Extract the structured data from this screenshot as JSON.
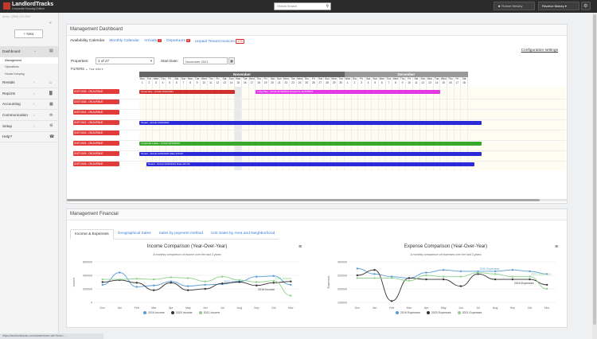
{
  "topbar": {
    "logo_main": "LandlordTracks",
    "logo_sub": "Corporate Housing Edition",
    "search_placeholder": "Global Search",
    "user_button": "Robert Wesley",
    "money_button": "Receive Money"
  },
  "sidebar": {
    "url_text": "demo • (555) 123-4567",
    "new_label": "+ New",
    "items": [
      {
        "label": "Dashboard",
        "active": true,
        "icon": "dashboard-icon",
        "glyph": "▤"
      },
      {
        "label": "Rentals",
        "icon": "home-icon",
        "glyph": "⌂"
      },
      {
        "label": "Reports",
        "icon": "bar-chart-icon",
        "glyph": "▓"
      },
      {
        "label": "Accounting",
        "icon": "calculator-icon",
        "glyph": "▦"
      },
      {
        "label": "Communication",
        "icon": "envelope-icon",
        "glyph": "✉"
      },
      {
        "label": "Setup",
        "icon": "gear-icon",
        "glyph": "⚙"
      },
      {
        "label": "Help?",
        "icon": "headset-icon",
        "glyph": "☎"
      }
    ],
    "subitems": [
      "Management",
      "Operations",
      "House Keeping"
    ]
  },
  "dashboard": {
    "title": "Management Dashboard",
    "tabs": [
      {
        "label": "Availability Calendar",
        "active": true
      },
      {
        "label": "Monthly Calendar"
      },
      {
        "label": "Arrivals",
        "badge": "2"
      },
      {
        "label": "Departures",
        "badge": "8"
      },
      {
        "label": "Unpaid Tenant Invoices",
        "badge": "175",
        "outline": true
      }
    ],
    "config_link": "Configuration settings",
    "properties_label": "Properties:",
    "properties_value": "1 of 27",
    "start_date_label": "Start Date:",
    "start_date_value": "November 2021",
    "filters_label": "FILTERS",
    "filters_hint": "Your units ▾",
    "months": [
      "November",
      "December"
    ],
    "days_nov": [
      {
        "w": "Mon",
        "d": "1"
      },
      {
        "w": "Tue",
        "d": "2"
      },
      {
        "w": "Wed",
        "d": "3"
      },
      {
        "w": "Thu",
        "d": "4"
      },
      {
        "w": "Fri",
        "d": "5"
      },
      {
        "w": "Sat",
        "d": "6"
      },
      {
        "w": "Sun",
        "d": "7"
      },
      {
        "w": "Mon",
        "d": "8"
      },
      {
        "w": "Tue",
        "d": "9"
      },
      {
        "w": "Wed",
        "d": "10"
      },
      {
        "w": "Thu",
        "d": "11"
      },
      {
        "w": "Fri",
        "d": "12"
      },
      {
        "w": "Sat",
        "d": "13"
      },
      {
        "w": "Sun",
        "d": "14"
      },
      {
        "w": "Mon",
        "d": "15"
      },
      {
        "w": "Tue",
        "d": "16"
      },
      {
        "w": "Wed",
        "d": "17"
      },
      {
        "w": "Thu",
        "d": "18"
      },
      {
        "w": "Fri",
        "d": "19"
      },
      {
        "w": "Sat",
        "d": "20"
      },
      {
        "w": "Sun",
        "d": "21"
      },
      {
        "w": "Mon",
        "d": "22"
      },
      {
        "w": "Tue",
        "d": "23"
      },
      {
        "w": "Wed",
        "d": "24"
      },
      {
        "w": "Thu",
        "d": "25"
      },
      {
        "w": "Fri",
        "d": "26"
      },
      {
        "w": "Sat",
        "d": "27"
      },
      {
        "w": "Sun",
        "d": "28"
      },
      {
        "w": "Mon",
        "d": "29"
      },
      {
        "w": "Tue",
        "d": "30"
      }
    ],
    "days_dec": [
      {
        "w": "Wed",
        "d": "1"
      },
      {
        "w": "Thu",
        "d": "2"
      },
      {
        "w": "Fri",
        "d": "3"
      },
      {
        "w": "Sat",
        "d": "4"
      },
      {
        "w": "Sun",
        "d": "5"
      },
      {
        "w": "Mon",
        "d": "6"
      },
      {
        "w": "Tue",
        "d": "7"
      },
      {
        "w": "Wed",
        "d": "8"
      },
      {
        "w": "Thu",
        "d": "9"
      },
      {
        "w": "Fri",
        "d": "10"
      },
      {
        "w": "Sat",
        "d": "11"
      },
      {
        "w": "Sun",
        "d": "12"
      },
      {
        "w": "Mon",
        "d": "13"
      },
      {
        "w": "Tue",
        "d": "14"
      },
      {
        "w": "Wed",
        "d": "15"
      },
      {
        "w": "Thu",
        "d": "16"
      },
      {
        "w": "Fri",
        "d": "17"
      },
      {
        "w": "Sat",
        "d": "18"
      }
    ],
    "units": [
      {
        "name": "UNIT 0035 - ON AVENUE"
      },
      {
        "name": "UNIT 0036 - ON AVENUE"
      },
      {
        "name": "UNIT 0041 - ON AVENUE"
      },
      {
        "name": "UNIT 0042 - ON AVENUE"
      },
      {
        "name": "UNIT 0043 - ON AVENUE"
      },
      {
        "name": "UNIT 0044 - ON AVENUE"
      },
      {
        "name": "UNIT 0045 - ON AVENUE"
      },
      {
        "name": "UNIT 0046 - ON AVENUE"
      }
    ],
    "bookings": [
      {
        "row": 0,
        "start_day": 1,
        "end_day": 14,
        "color": "#d0302f",
        "text": "Guest stay - Arrival 11/01/2021"
      },
      {
        "row": 0,
        "start_day": 18,
        "end_day": 44,
        "color": "#e238e8",
        "text": "Long Stay - Arrival 11/18/2021 Departure 12/12/2021"
      },
      {
        "row": 3,
        "start_day": 1,
        "end_day": 50,
        "color": "#2a2ad8",
        "text": "Tenant - Arrival 11/01/2021"
      },
      {
        "row": 5,
        "start_day": 1,
        "end_day": 50,
        "color": "#3aa82a",
        "text": "Corporate Lease - Arrival 10/15/2021"
      },
      {
        "row": 6,
        "start_day": 1,
        "end_day": 50,
        "color": "#2a2ad8",
        "text": "Tenant - Arrival 11/01/2021 Rate 210.00"
      },
      {
        "row": 7,
        "start_day": 2,
        "end_day": 49,
        "color": "#2a2ad8",
        "text": "Tenant - Arrival 11/02/2021 Rate 210.00"
      }
    ]
  },
  "financial": {
    "title": "Management Financial",
    "tabs": [
      {
        "label": "Income & Expenses",
        "active": true
      },
      {
        "label": "Geographical Sales"
      },
      {
        "label": "Sales by payment method"
      },
      {
        "label": "Unit Sales by Area and Neighborhood"
      }
    ]
  },
  "chart_data": [
    {
      "type": "line",
      "title": "Income Comparison (Year-Over-Year)",
      "subtitle": "A monthly comparison of income over the last 3 years",
      "ylabel": "Income",
      "ylim": [
        0,
        600000
      ],
      "yticks": [
        "0",
        "200000",
        "400000",
        "600000"
      ],
      "categories": [
        "Dec",
        "Jan",
        "Feb",
        "Mar",
        "Apr",
        "May",
        "Jun",
        "Jul",
        "Aug",
        "Sep",
        "Oct",
        "Nov"
      ],
      "series": [
        {
          "name": "2019 Income",
          "color": "#5b9bd5",
          "values": [
            260000,
            440000,
            230000,
            250000,
            310000,
            240000,
            260000,
            270000,
            310000,
            380000,
            390000,
            260000
          ]
        },
        {
          "name": "2020 Income",
          "color": "#333333",
          "values": [
            300000,
            330000,
            290000,
            180000,
            290000,
            180000,
            200000,
            280000,
            300000,
            250000,
            290000,
            310000
          ]
        },
        {
          "name": "2021 Income",
          "color": "#8fd18f",
          "values": [
            340000,
            340000,
            350000,
            340000,
            370000,
            360000,
            310000,
            380000,
            330000,
            300000,
            320000,
            100000
          ]
        }
      ],
      "annotations": [
        "2020 Income",
        "2019 Income",
        "2021 Income"
      ]
    },
    {
      "type": "line",
      "title": "Expense Comparison (Year-Over-Year)",
      "subtitle": "A monthly comparison of expenses over the last 3 years",
      "ylabel": "Expenses",
      "ylim": [
        100000,
        400000
      ],
      "yticks": [
        "100000",
        "200000",
        "300000",
        "400000"
      ],
      "categories": [
        "Dec",
        "Jan",
        "Feb",
        "Mar",
        "Apr",
        "May",
        "Jun",
        "Jul",
        "Aug",
        "Sep",
        "Oct",
        "Nov"
      ],
      "series": [
        {
          "name": "2019 Expenses",
          "color": "#5b9bd5",
          "values": [
            350000,
            310000,
            290000,
            280000,
            320000,
            340000,
            330000,
            330000,
            330000,
            340000,
            330000,
            310000
          ]
        },
        {
          "name": "2020 Expenses",
          "color": "#333333",
          "values": [
            300000,
            340000,
            110000,
            280000,
            270000,
            270000,
            220000,
            310000,
            270000,
            270000,
            270000,
            230000
          ]
        },
        {
          "name": "2021 Expenses",
          "color": "#8fd18f",
          "values": [
            280000,
            280000,
            280000,
            260000,
            300000,
            290000,
            290000,
            320000,
            310000,
            290000,
            290000,
            200000
          ]
        }
      ],
      "annotations": [
        "2020 Expenses",
        "2019 Expenses",
        "2021 Expenses"
      ]
    }
  ],
  "status_url": "https://landlordtracks.com/admin/index.cfm?fuse=..."
}
